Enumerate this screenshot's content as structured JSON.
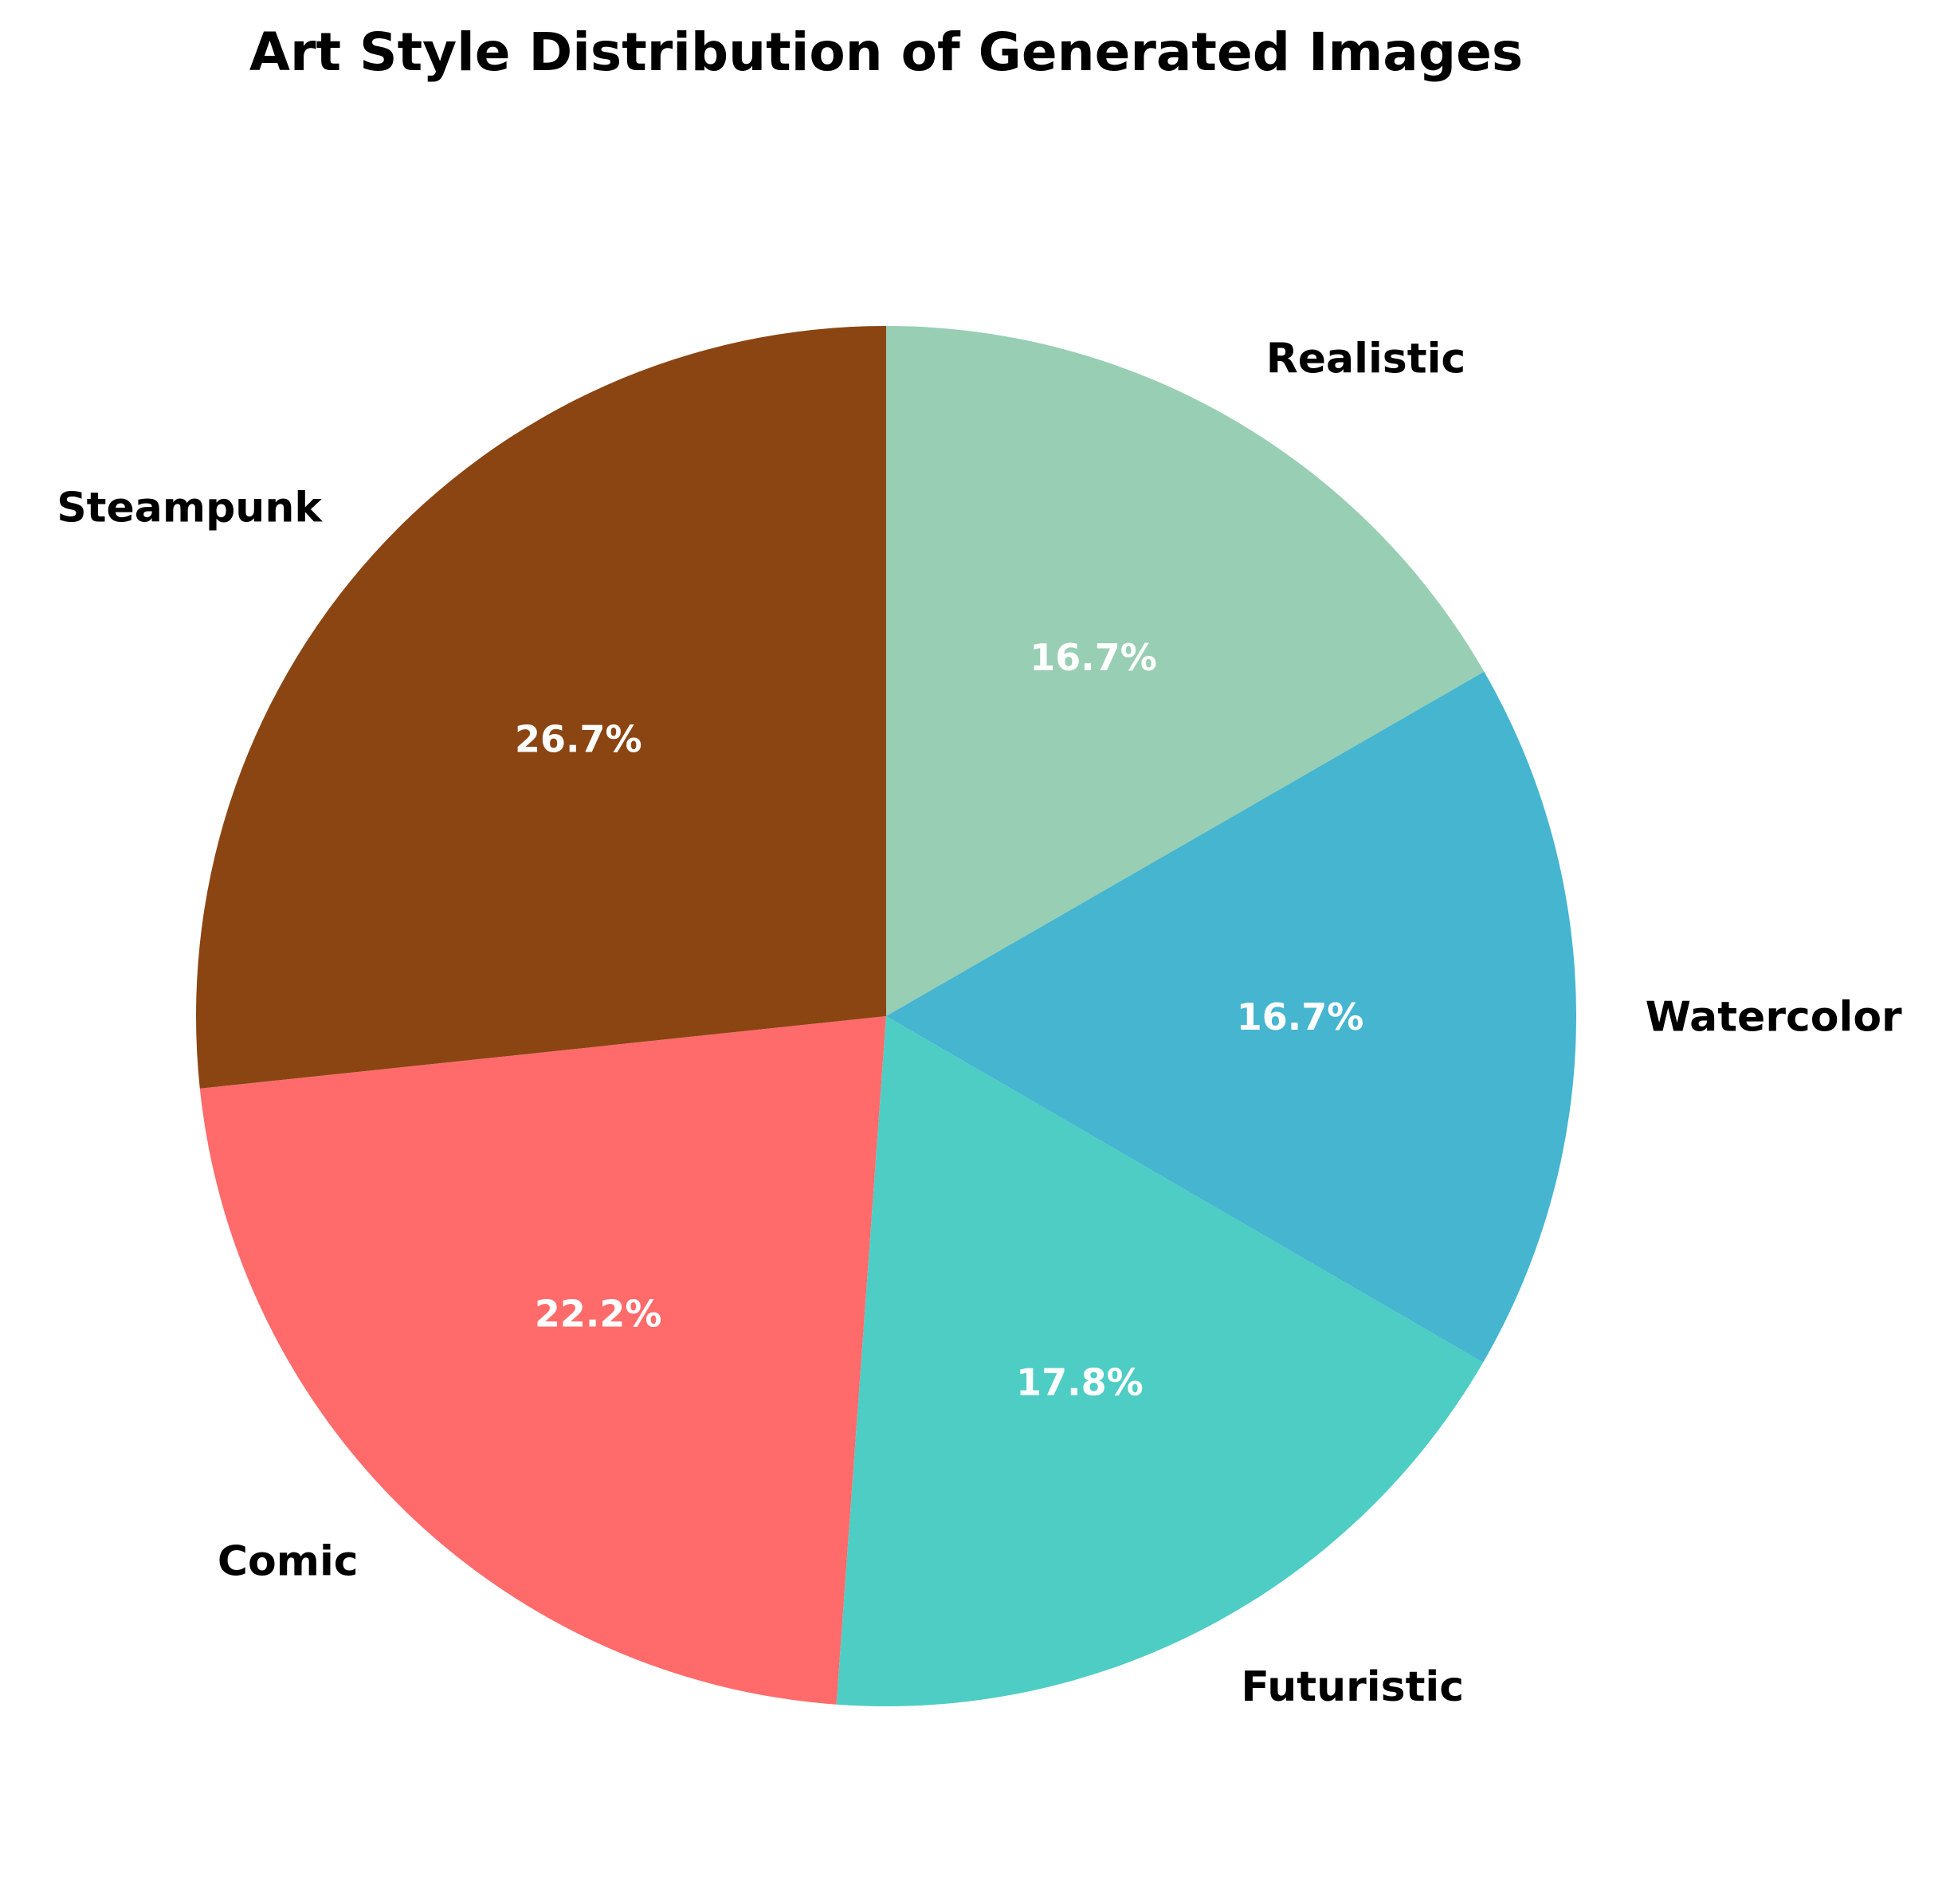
{
  "chart_data": {
    "type": "pie",
    "title": "Art Style Distribution of Generated Images",
    "categories": [
      "Realistic",
      "Watercolor",
      "Futuristic",
      "Comic",
      "Steampunk"
    ],
    "values": [
      16.7,
      16.7,
      17.8,
      22.2,
      26.7
    ],
    "value_labels": [
      "16.7%",
      "16.7%",
      "17.8%",
      "22.2%",
      "26.7%"
    ],
    "colors": [
      "#98CEB3",
      "#45B5D0",
      "#4ECDC4",
      "#FF6B6B",
      "#8B4513"
    ],
    "start_angle_deg": 90,
    "direction": "clockwise",
    "legend": "none"
  }
}
